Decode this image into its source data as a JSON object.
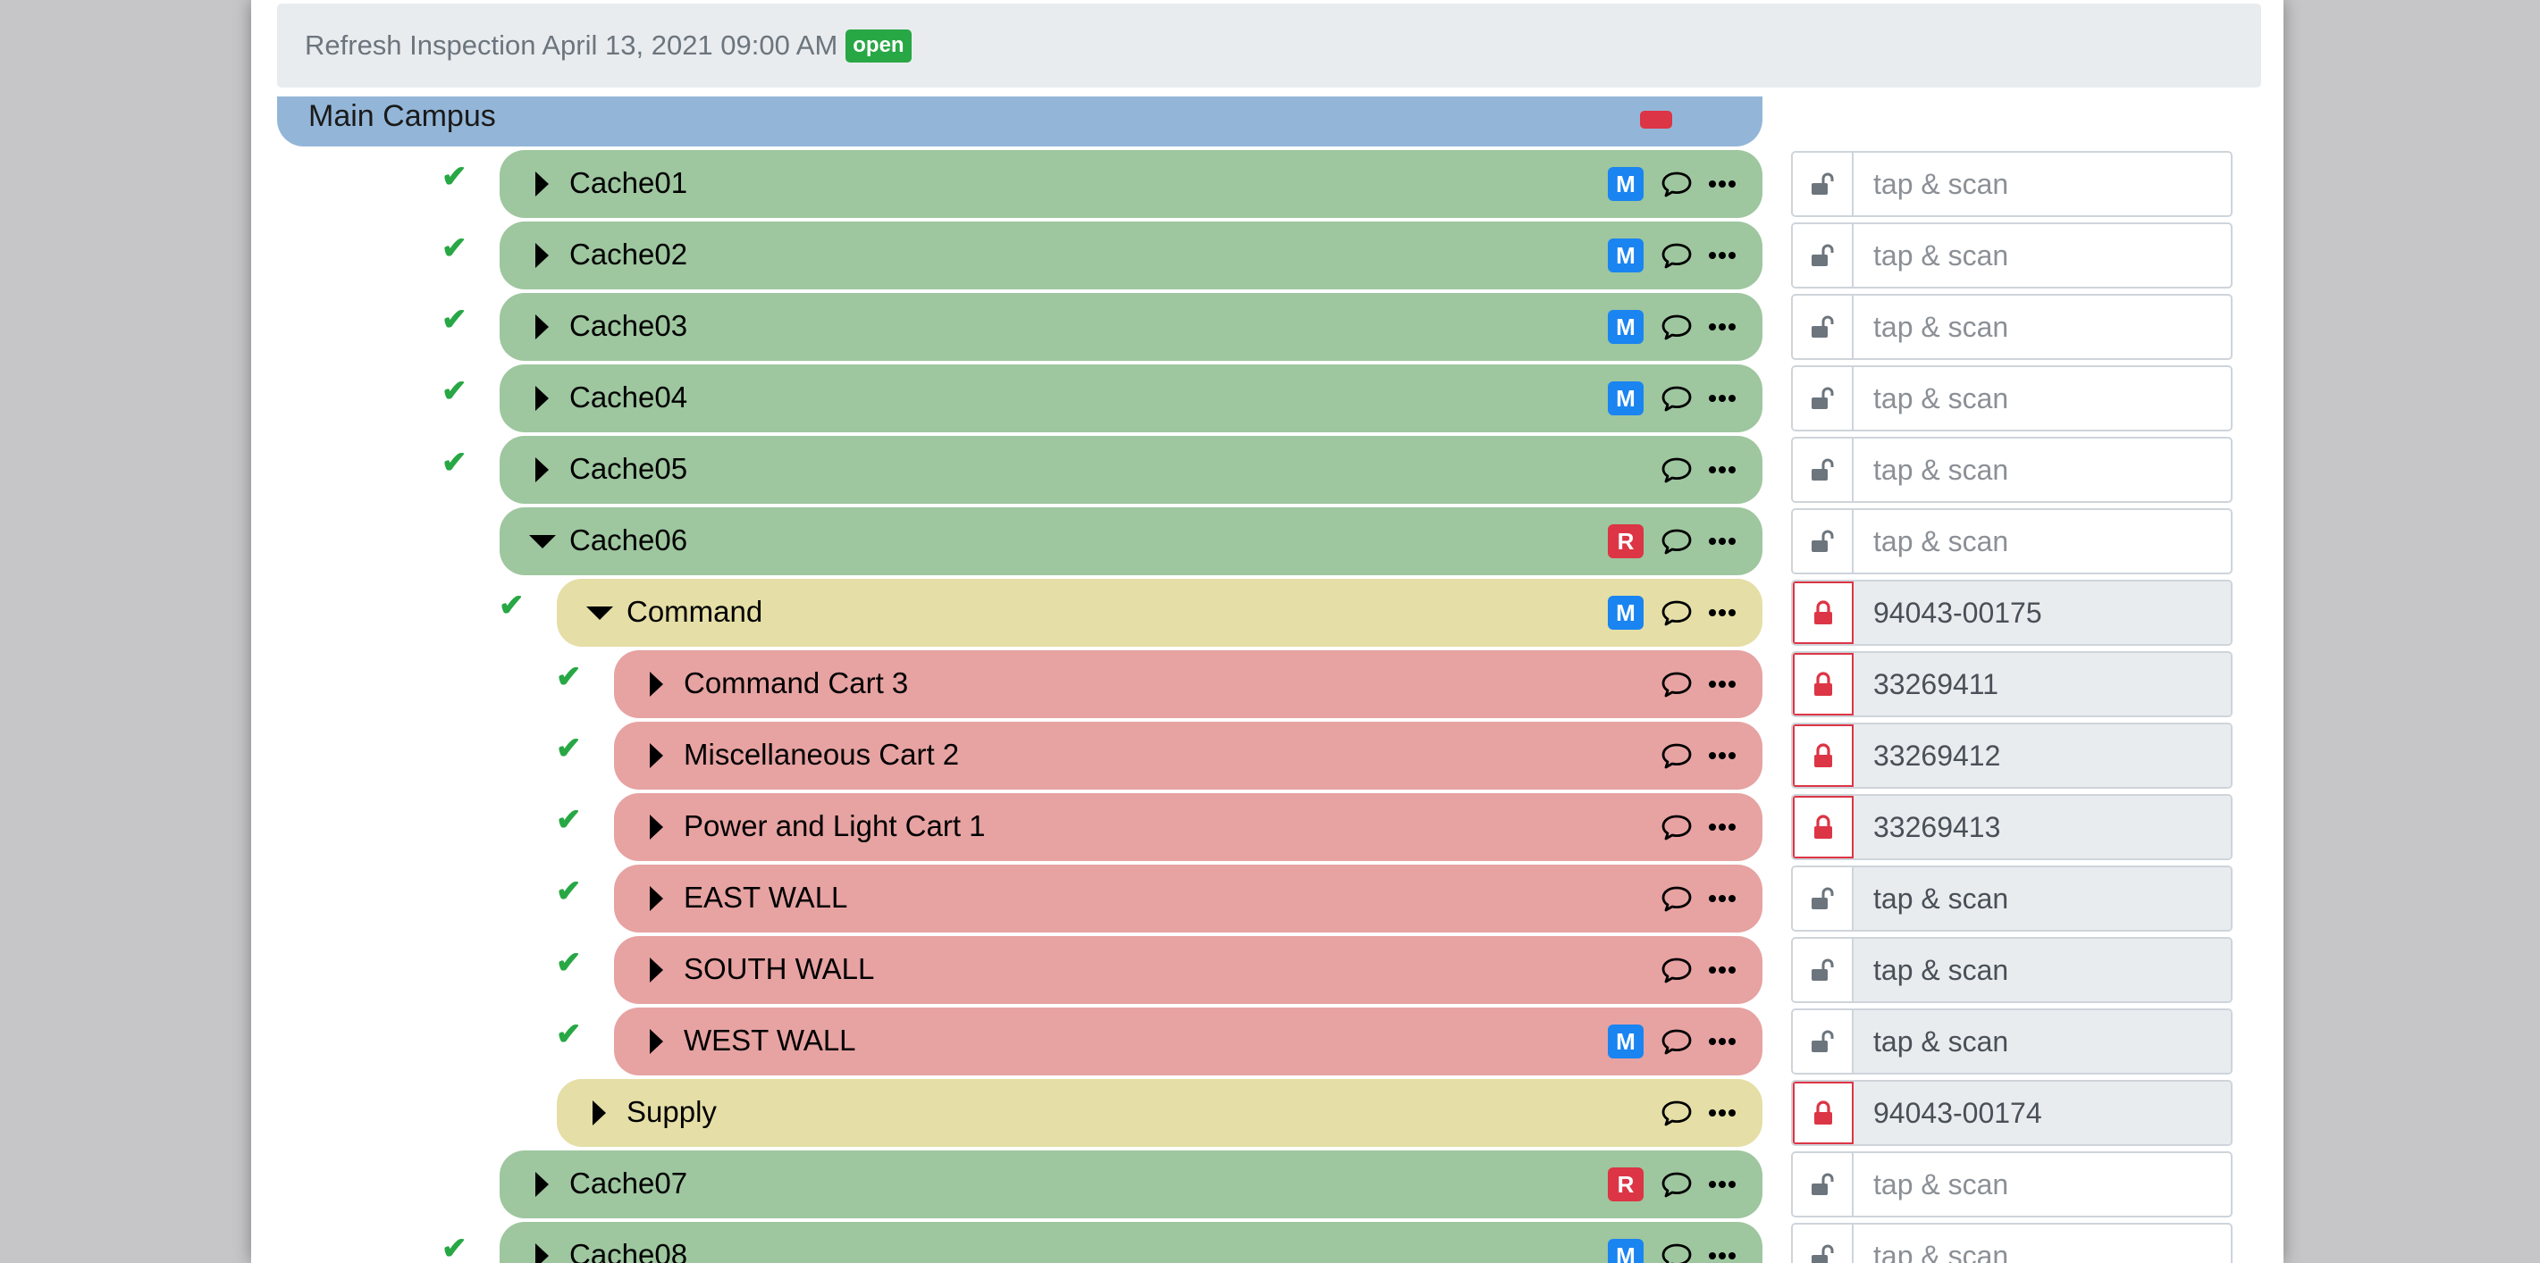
{
  "colors": {
    "green_row": "#9ec69f",
    "yellow_row": "#e5dea6",
    "red_row": "#e7a2a2",
    "group_row": "#93b6d8",
    "badge_m": "#1a84f1",
    "badge_r": "#dc3545",
    "check": "#28a745",
    "status_open": "#28a745"
  },
  "header": {
    "title": "Refresh Inspection April 13, 2021 09:00 AM",
    "status": "open"
  },
  "group": {
    "label": "Main Campus"
  },
  "scan_placeholder": "tap & scan",
  "rows": [
    {
      "label": "Cache01",
      "checked": true,
      "expanded": false,
      "badge": "M",
      "scan_value": "",
      "locked": false
    },
    {
      "label": "Cache02",
      "checked": true,
      "expanded": false,
      "badge": "M",
      "scan_value": "",
      "locked": false
    },
    {
      "label": "Cache03",
      "checked": true,
      "expanded": false,
      "badge": "M",
      "scan_value": "",
      "locked": false
    },
    {
      "label": "Cache04",
      "checked": true,
      "expanded": false,
      "badge": "M",
      "scan_value": "",
      "locked": false
    },
    {
      "label": "Cache05",
      "checked": true,
      "expanded": false,
      "badge": "",
      "scan_value": "",
      "locked": false
    },
    {
      "label": "Cache06",
      "checked": false,
      "expanded": true,
      "badge": "R",
      "scan_value": "",
      "locked": false
    },
    {
      "label": "Command",
      "checked": true,
      "expanded": true,
      "badge": "M",
      "scan_value": "94043-00175",
      "locked": true
    },
    {
      "label": "Command Cart 3",
      "checked": true,
      "expanded": false,
      "badge": "",
      "scan_value": "33269411",
      "locked": true
    },
    {
      "label": "Miscellaneous Cart 2",
      "checked": true,
      "expanded": false,
      "badge": "",
      "scan_value": "33269412",
      "locked": true
    },
    {
      "label": "Power and Light Cart 1",
      "checked": true,
      "expanded": false,
      "badge": "",
      "scan_value": "33269413",
      "locked": true
    },
    {
      "label": "EAST WALL",
      "checked": true,
      "expanded": false,
      "badge": "",
      "scan_value": "",
      "locked": false
    },
    {
      "label": "SOUTH WALL",
      "checked": true,
      "expanded": false,
      "badge": "",
      "scan_value": "",
      "locked": false
    },
    {
      "label": "WEST WALL",
      "checked": true,
      "expanded": false,
      "badge": "M",
      "scan_value": "",
      "locked": false
    },
    {
      "label": "Supply",
      "checked": false,
      "expanded": false,
      "badge": "",
      "scan_value": "94043-00174",
      "locked": true
    },
    {
      "label": "Cache07",
      "checked": false,
      "expanded": false,
      "badge": "R",
      "scan_value": "",
      "locked": false
    },
    {
      "label": "Cache08",
      "checked": true,
      "expanded": false,
      "badge": "M",
      "scan_value": "",
      "locked": false
    }
  ]
}
